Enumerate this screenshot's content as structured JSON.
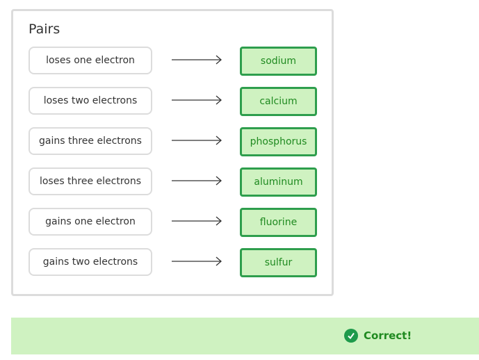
{
  "panel": {
    "title": "Pairs",
    "pairs": [
      {
        "left": "loses one electron",
        "right": "sodium"
      },
      {
        "left": "loses two electrons",
        "right": "calcium"
      },
      {
        "left": "gains three electrons",
        "right": "phosphorus"
      },
      {
        "left": "loses three electrons",
        "right": "aluminum"
      },
      {
        "left": "gains one electron",
        "right": "fluorine"
      },
      {
        "left": "gains two electrons",
        "right": "sulfur"
      }
    ]
  },
  "feedback": {
    "icon": "check-circle-icon",
    "text": "Correct!",
    "color": "#1f8a20",
    "background": "#cff2c1"
  }
}
